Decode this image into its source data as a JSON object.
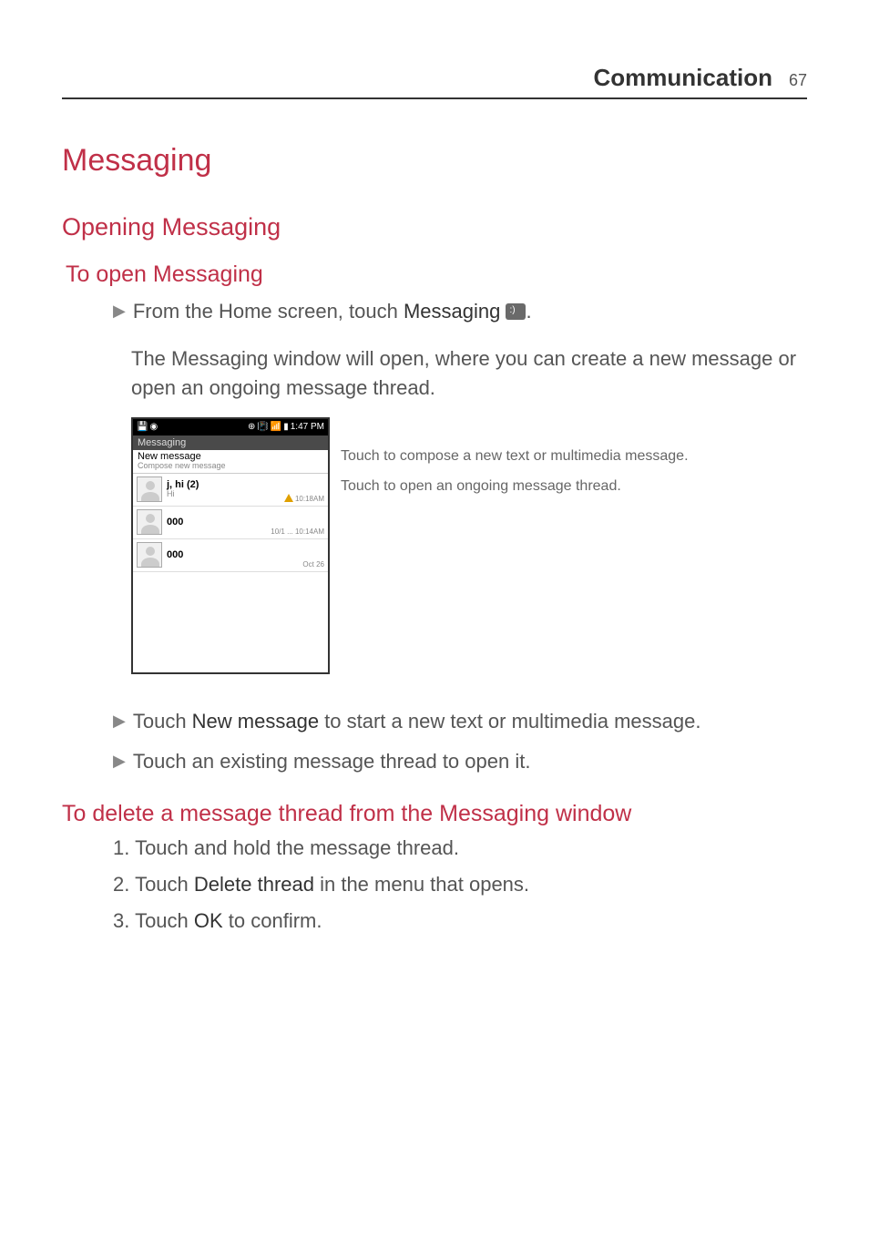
{
  "header": {
    "section": "Communication",
    "page": "67"
  },
  "h1": "Messaging",
  "h2": "Opening Messaging",
  "h3a": "To open Messaging",
  "bullet1_pre": "From the Home screen, touch ",
  "bullet1_bold": "Messaging",
  "bullet1_post": " ",
  "bullet1_end": ".",
  "para1": "The Messaging window will open, where you can create a new message or open an ongoing message thread.",
  "phone": {
    "time": "1:47 PM",
    "title": "Messaging",
    "new_label": "New message",
    "new_sub": "Compose new message",
    "threads": [
      {
        "name": "j, hi (2)",
        "preview": "Hi",
        "time": "10:18AM",
        "warn": true
      },
      {
        "name": "000",
        "preview": "",
        "time": "10/1 ... 10:14AM",
        "warn": false
      },
      {
        "name": "000",
        "preview": "",
        "time": "Oct 26",
        "warn": false
      }
    ]
  },
  "anno1": "Touch to compose a new text or multimedia message.",
  "anno2": "Touch to open an ongoing message thread.",
  "bullet2_pre": " Touch ",
  "bullet2_bold": "New message",
  "bullet2_post": " to start a new text or multimedia message.",
  "bullet3": "Touch an existing message thread to open it.",
  "h3b": "To delete a message thread from the Messaging window",
  "step1": "1. Touch and hold the message thread.",
  "step2_pre": "2. Touch ",
  "step2_bold": "Delete thread",
  "step2_post": " in the menu that opens.",
  "step3_pre": "3. Touch ",
  "step3_bold": "OK",
  "step3_post": " to confirm."
}
